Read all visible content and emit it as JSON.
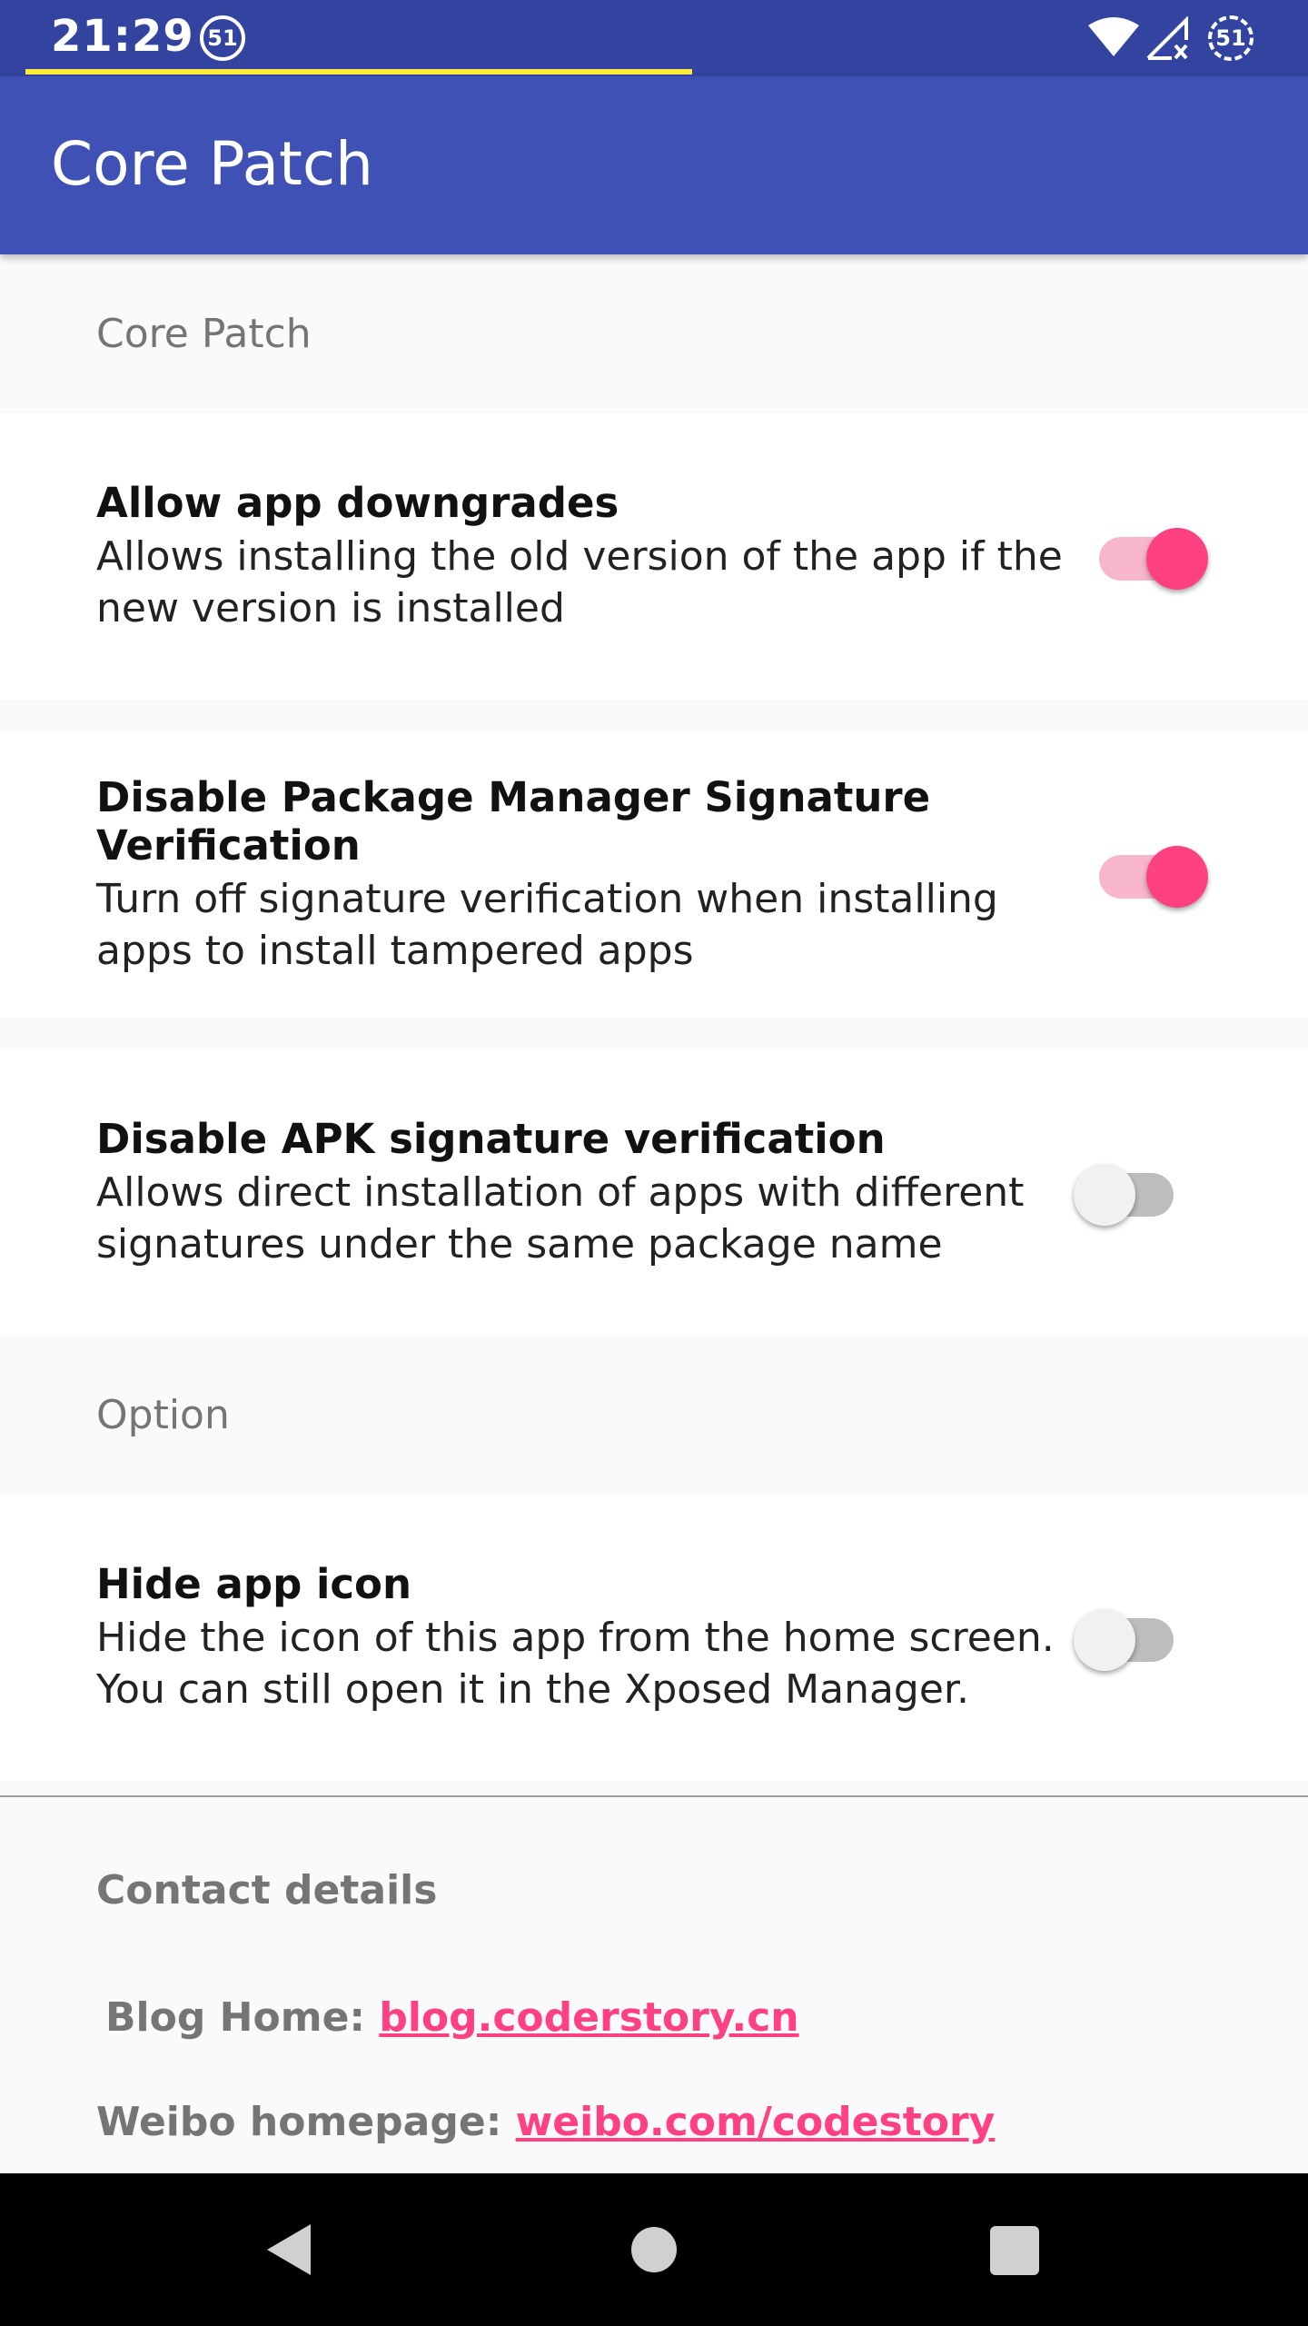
{
  "status_bar": {
    "time": "21:29",
    "notification_badge": "51",
    "battery_badge": "51",
    "progress": 0.53,
    "progress_color": "#ffeb3b",
    "icons": [
      "wifi-icon",
      "signal-icon"
    ]
  },
  "app_bar": {
    "title": "Core Patch",
    "color": "#3f51b5"
  },
  "sections": {
    "core_patch": {
      "title": "Core Patch",
      "items": [
        {
          "title": "Allow app downgrades",
          "summary": "Allows installing the old version of the app if the new version is installed",
          "enabled": true
        },
        {
          "title": "Disable Package Manager Signature Verification",
          "summary": "Turn off signature verification when installing apps to install tampered apps",
          "enabled": true
        },
        {
          "title": "Disable APK signature verification",
          "summary": "Allows direct installation of apps with different signatures under the same package name",
          "enabled": false
        }
      ]
    },
    "option": {
      "title": "Option",
      "items": [
        {
          "title": "Hide app icon",
          "summary": "Hide the icon of this app from the home screen. You can still open it in the Xposed Manager.",
          "enabled": false
        }
      ]
    }
  },
  "contact": {
    "heading": "Contact details",
    "blog_label": "Blog Home:",
    "blog_link": "blog.coderstory.cn",
    "weibo_label": "Weibo homepage:",
    "weibo_link": "weibo.com/codestory"
  },
  "colors": {
    "accent": "#ff4081",
    "accent_track": "#f8b6cc",
    "status_bar": "#3244a0"
  },
  "nav_bar": {
    "icons": [
      "back-icon",
      "home-icon",
      "recents-icon"
    ]
  }
}
